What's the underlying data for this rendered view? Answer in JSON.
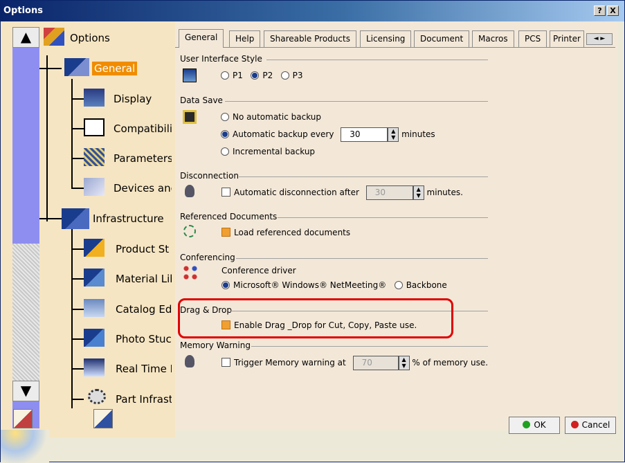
{
  "window": {
    "title": "Options",
    "help_btn": "?",
    "close_btn": "X"
  },
  "tree": {
    "scroll_up": "▲",
    "scroll_down": "▼",
    "items": [
      {
        "label": "Options",
        "icon": "options-tree-icon"
      },
      {
        "label": "General",
        "icon": "general-icon"
      },
      {
        "label": "Display",
        "icon": "display-icon"
      },
      {
        "label": "Compatibilit",
        "icon": "compatibility-icon"
      },
      {
        "label": "Parameters",
        "icon": "parameters-icon"
      },
      {
        "label": "Devices anc",
        "icon": "devices-icon"
      },
      {
        "label": "Infrastructure",
        "icon": "infrastructure-icon"
      },
      {
        "label": "Product St",
        "icon": "product-structure-icon"
      },
      {
        "label": "Material Lib",
        "icon": "material-library-icon"
      },
      {
        "label": "Catalog Ed",
        "icon": "catalog-editor-icon"
      },
      {
        "label": "Photo Stuc",
        "icon": "photo-studio-icon"
      },
      {
        "label": "Real Time F",
        "icon": "real-time-icon"
      },
      {
        "label": "Part Infrast",
        "icon": "part-infrastructure-icon"
      }
    ]
  },
  "tabs": [
    "General",
    "Help",
    "Shareable Products",
    "Licensing",
    "Document",
    "Macros",
    "PCS",
    "Printer"
  ],
  "tab_arrows": "◄ ►",
  "ui_style": {
    "title": "User Interface Style",
    "options": [
      "P1",
      "P2",
      "P3"
    ],
    "selected": "P2"
  },
  "data_save": {
    "title": "Data Save",
    "opt_none": "No automatic backup",
    "opt_auto": "Automatic backup every",
    "auto_value": "30",
    "auto_unit": "minutes",
    "opt_incremental": "Incremental backup"
  },
  "disconnection": {
    "title": "Disconnection",
    "label": "Automatic disconnection after",
    "value": "30",
    "unit": "minutes."
  },
  "referenced": {
    "title": "Referenced Documents",
    "label": "Load referenced documents"
  },
  "conferencing": {
    "title": "Conferencing",
    "driver_label": "Conference driver",
    "opt1": "Microsoft® Windows® NetMeeting®",
    "opt2": "Backbone"
  },
  "dragdrop": {
    "title": "Drag & Drop",
    "label": "Enable Drag _Drop for Cut, Copy, Paste use."
  },
  "memory": {
    "title": "Memory Warning",
    "label": "Trigger Memory warning at",
    "value": "70",
    "unit": "% of memory use."
  },
  "buttons": {
    "ok": "OK",
    "cancel": "Cancel"
  },
  "colors": {
    "titlebar": "#0a246a",
    "tree_bg": "#f6e5c2",
    "panel_bg": "#f3e8d8",
    "highlight": "#e00000",
    "selected": "#f08c00"
  }
}
